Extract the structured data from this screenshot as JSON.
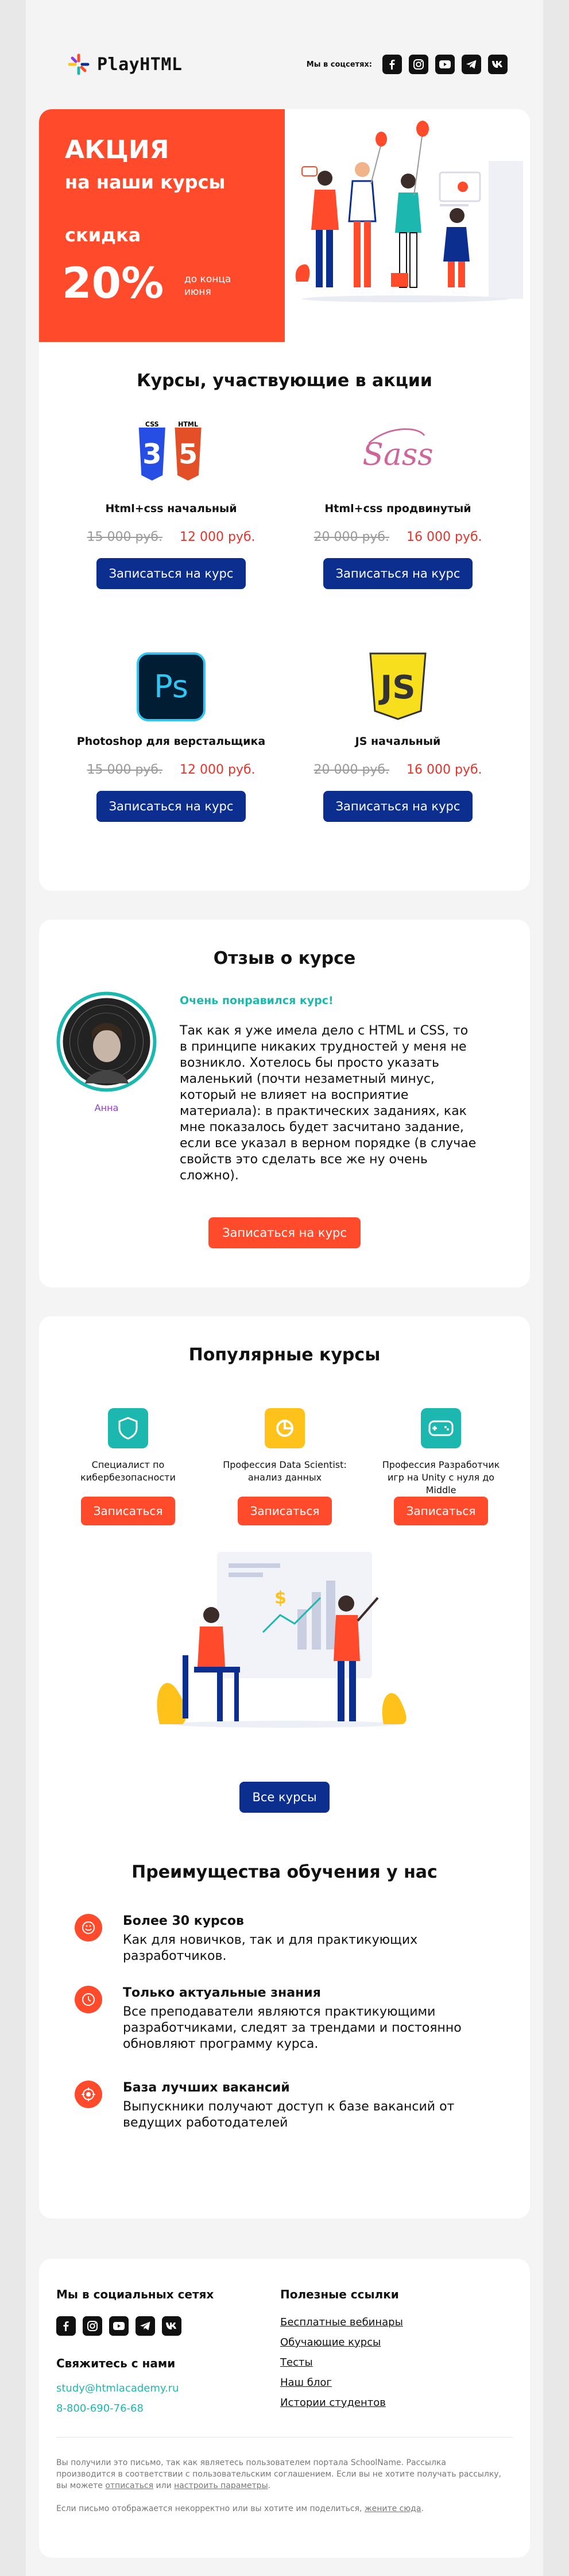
{
  "header": {
    "logo_text": "PlayHTML",
    "social_label": "Мы в соцсетях:",
    "social_icons": [
      "facebook-icon",
      "instagram-icon",
      "youtube-icon",
      "telegram-icon",
      "vk-icon"
    ]
  },
  "hero": {
    "line1": "АКЦИЯ",
    "line2": "на наши курсы",
    "line3": "скидка",
    "percent": "20%",
    "until_1": "до конца",
    "until_2": "июня"
  },
  "courses": {
    "title": "Курсы, участвующие в акции",
    "button_label": "Записаться на курс",
    "items": [
      {
        "name": "Html+css начальный",
        "old_price": "15 000 руб.",
        "new_price": "12 000 руб.",
        "icon": "html-css-icon"
      },
      {
        "name": "Html+css продвинутый",
        "old_price": "20 000 руб.",
        "new_price": "16 000 руб.",
        "icon": "sass-icon"
      },
      {
        "name": "Photoshop для верстальщика",
        "old_price": "15 000 руб.",
        "new_price": "12 000 руб.",
        "icon": "photoshop-icon"
      },
      {
        "name": "JS начальный",
        "old_price": "20 000 руб.",
        "new_price": "16 000 руб.",
        "icon": "js-icon"
      }
    ]
  },
  "review": {
    "title": "Отзыв о курсе",
    "author": "Анна",
    "headline": "Очень понравился курс!",
    "text": "Так как я уже имела дело с HTML и CSS, то в принципе никаких трудностей у меня не возникло. Хотелось бы просто указать маленький (почти незаметный минус, который не влияет на восприятие материала): в практических заданиях, как мне показалось будет засчитано задание, если все указал в верном порядке (в случае свойств это сделать все же ну очень сложно).",
    "button_label": "Записаться на курс"
  },
  "popular": {
    "title": "Популярные курсы",
    "button_label": "Записаться",
    "all_label": "Все курсы",
    "items": [
      {
        "name": "Специалист по кибербезопасности",
        "icon": "shield-icon",
        "color": "#1cb8b0"
      },
      {
        "name": "Профессия Data Scientist: анализ данных",
        "icon": "chart-icon",
        "color": "#ffc21a"
      },
      {
        "name": "Профессия Разработчик игр на Unity с нуля до Middle",
        "icon": "gamepad-icon",
        "color": "#1cb8b0"
      }
    ]
  },
  "benefits": {
    "title": "Преимущества обучения у нас",
    "items": [
      {
        "title": "Более 30 курсов",
        "text": "Как для новичков, так и для практикующих разработчиков.",
        "icon": "smile-icon"
      },
      {
        "title": "Только актуальные знания",
        "text": "Все преподаватели являются практикующими разработчиками, следят за трендами и постоянно обновляют программу курса.",
        "icon": "clock-icon"
      },
      {
        "title": "База лучших вакансий",
        "text": "Выпускники получают доступ к базе вакансий от ведущих работодателей",
        "icon": "target-icon"
      }
    ]
  },
  "footer": {
    "social_title": "Мы в социальных сетях",
    "contact_title": "Свяжитесь с нами",
    "email": "study@htmlacademy.ru",
    "phone": "8-800-690-76-68",
    "links_title": "Полезные ссылки",
    "links": [
      "Бесплатные вебинары",
      "Обучающие курсы",
      "Тесты",
      "Наш блог",
      "Истории студентов"
    ],
    "legal_1": "Вы получили это письмо, так как являетесь пользователем портала SchoolName. Рассылка производится в соответствии с пользовательским соглашением. Если вы не хотите получать рассылку, вы можете ",
    "legal_unsub": "отписаться",
    "legal_or": " или ",
    "legal_settings": "настроить параметры",
    "legal_2": "Если письмо отображается некорректно или вы хотите им поделиться, ",
    "legal_web": "жените сюда"
  },
  "colors": {
    "accent": "#ff4b2b",
    "blue": "#0b2e8f",
    "teal": "#1cb8b0"
  }
}
